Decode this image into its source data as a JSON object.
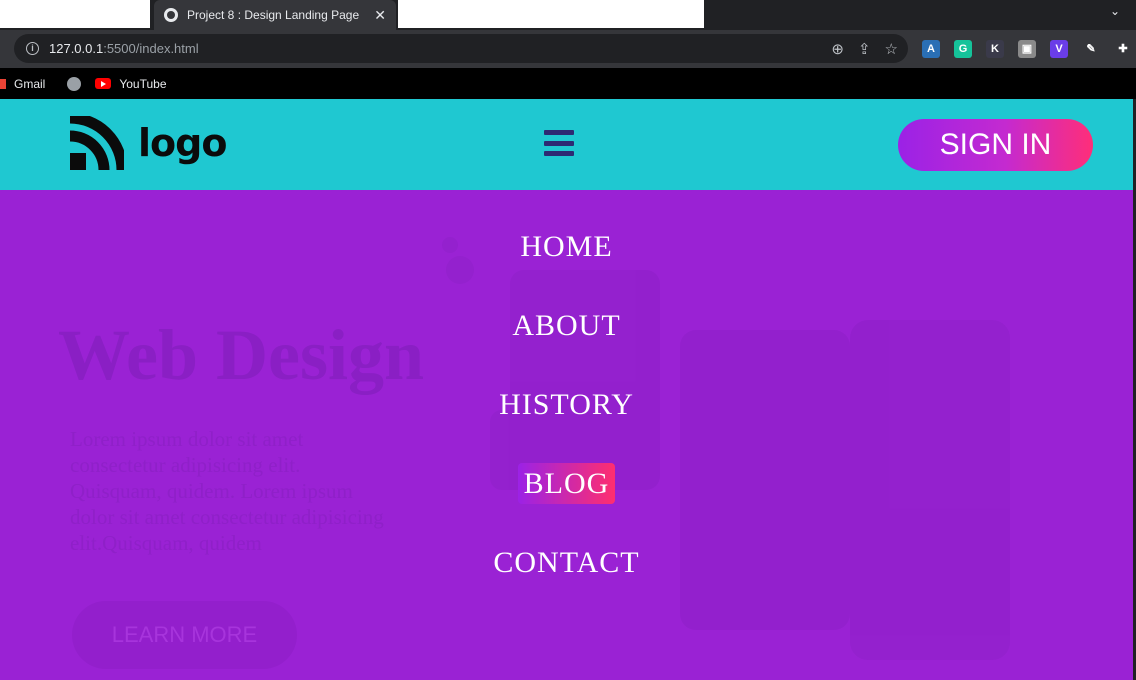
{
  "browser": {
    "tab_title": "Project 8 : Design Landing Page",
    "tab_close": "✕",
    "url_host": "127.0.0.1",
    "url_path": ":5500/index.html",
    "bookmarks": [
      {
        "label": "Gmail"
      },
      {
        "label": ""
      },
      {
        "label": "YouTube"
      }
    ],
    "icons": [
      "zoom-icon",
      "share-icon",
      "star-icon"
    ],
    "extensions": [
      {
        "glyph": "A",
        "color": "#2a6fb5"
      },
      {
        "glyph": "G",
        "color": "#15c39a"
      },
      {
        "glyph": "K",
        "color": "#3a3a4a"
      },
      {
        "glyph": "▣",
        "color": "#8a8a8a"
      },
      {
        "glyph": "V",
        "color": "#6a3de8"
      },
      {
        "glyph": "✎",
        "color": "#35363a"
      },
      {
        "glyph": "✚",
        "color": "#35363a"
      }
    ]
  },
  "site": {
    "logo_text": "logo",
    "signin_label": "SIGN IN",
    "hero_title": "Web Design",
    "hero_text": "Lorem ipsum dolor sit amet consectetur adipisicing elit. Quisquam, quidem. Lorem ipsum dolor sit amet consectetur adipisicing elit.Quisquam, quidem",
    "hero_button": "LEARN MORE",
    "menu": [
      {
        "label": "HOME",
        "active": false
      },
      {
        "label": "ABOUT",
        "active": false
      },
      {
        "label": "HISTORY",
        "active": false
      },
      {
        "label": "BLOG",
        "active": true
      },
      {
        "label": "CONTACT",
        "active": false
      }
    ],
    "colors": {
      "header_bg": "#1fc8d1",
      "hero_bg": "#9a22d4",
      "accent_start": "#9b22e6",
      "accent_end": "#ff2e79",
      "hamburger": "#2d2a73"
    }
  }
}
